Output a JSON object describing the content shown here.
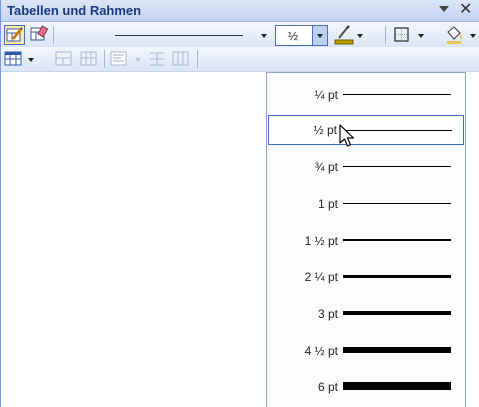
{
  "window": {
    "title": "Tabellen und Rahmen"
  },
  "toolbar": {
    "weight_value": "½",
    "colors": {
      "pen_color": "#c0a000",
      "fill_color": "#e8c45c"
    }
  },
  "weight_menu": {
    "items": [
      {
        "label": "¼ pt",
        "pt": 0.25,
        "selected": false
      },
      {
        "label": "½ pt",
        "pt": 0.5,
        "selected": true
      },
      {
        "label": "¾ pt",
        "pt": 0.75,
        "selected": false
      },
      {
        "label": "1 pt",
        "pt": 1,
        "selected": false
      },
      {
        "label": "1 ½ pt",
        "pt": 1.5,
        "selected": false
      },
      {
        "label": "2 ¼ pt",
        "pt": 2.25,
        "selected": false
      },
      {
        "label": "3 pt",
        "pt": 3,
        "selected": false
      },
      {
        "label": "4 ½ pt",
        "pt": 4.5,
        "selected": false
      },
      {
        "label": "6 pt",
        "pt": 6,
        "selected": false
      }
    ]
  }
}
